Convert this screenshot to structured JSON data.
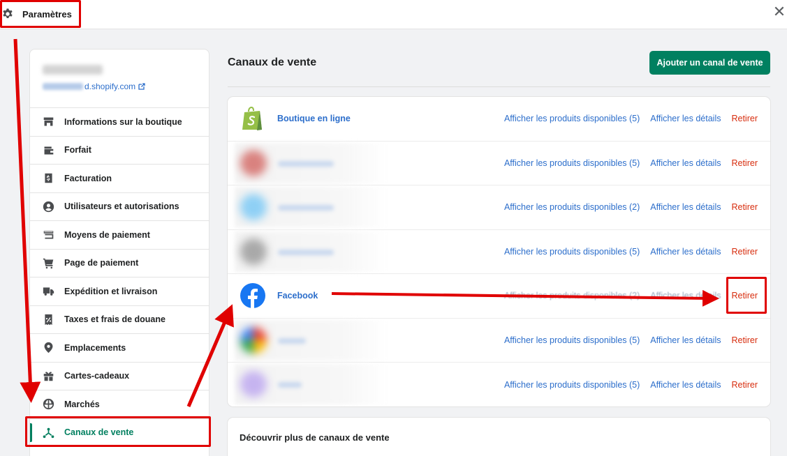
{
  "topbar": {
    "title": "Paramètres",
    "close_glyph": "✕",
    "icon": "gear-icon"
  },
  "sidebar": {
    "shop_url_suffix": "d.shopify.com",
    "items": [
      {
        "label": "Informations sur la boutique",
        "icon": "store-icon"
      },
      {
        "label": "Forfait",
        "icon": "wallet-icon"
      },
      {
        "label": "Facturation",
        "icon": "invoice-dollar-icon"
      },
      {
        "label": "Utilisateurs et autorisations",
        "icon": "user-icon"
      },
      {
        "label": "Moyens de paiement",
        "icon": "card-icon"
      },
      {
        "label": "Page de paiement",
        "icon": "cart-icon"
      },
      {
        "label": "Expédition et livraison",
        "icon": "truck-icon"
      },
      {
        "label": "Taxes et frais de douane",
        "icon": "tax-receipt-icon"
      },
      {
        "label": "Emplacements",
        "icon": "location-pin-icon"
      },
      {
        "label": "Cartes-cadeaux",
        "icon": "gift-icon"
      },
      {
        "label": "Marchés",
        "icon": "globe-icon"
      },
      {
        "label": "Canaux de vente",
        "icon": "sales-channels-icon",
        "active": true
      }
    ]
  },
  "main": {
    "title": "Canaux de vente",
    "add_button": "Ajouter un canal de vente",
    "view_details": "Afficher les détails",
    "remove": "Retirer",
    "channels": [
      {
        "name": "Boutique en ligne",
        "products": "Afficher les produits disponibles (5)",
        "icon": "shopify-bag-icon"
      },
      {
        "name": "",
        "products": "Afficher les produits disponibles (5)",
        "blur_color": "#d9827f"
      },
      {
        "name": "",
        "products": "Afficher les produits disponibles (2)",
        "blur_color": "#8fd0f5"
      },
      {
        "name": "",
        "products": "Afficher les produits disponibles (5)",
        "blur_color": "#a9a9a9"
      },
      {
        "name": "Facebook",
        "products": "Afficher les produits disponibles (2)",
        "icon": "facebook-icon"
      },
      {
        "name": "",
        "products": "Afficher les produits disponibles (5)",
        "blur_color": "#e9a46b"
      },
      {
        "name": "",
        "products": "Afficher les produits disponibles (5)",
        "blur_color": "#c6b4f0"
      }
    ],
    "discover_title": "Découvrir plus de canaux de vente"
  },
  "colors": {
    "accent": "#008060",
    "link": "#2c6ecb",
    "danger": "#d72c0d",
    "annotation": "#e00000"
  }
}
